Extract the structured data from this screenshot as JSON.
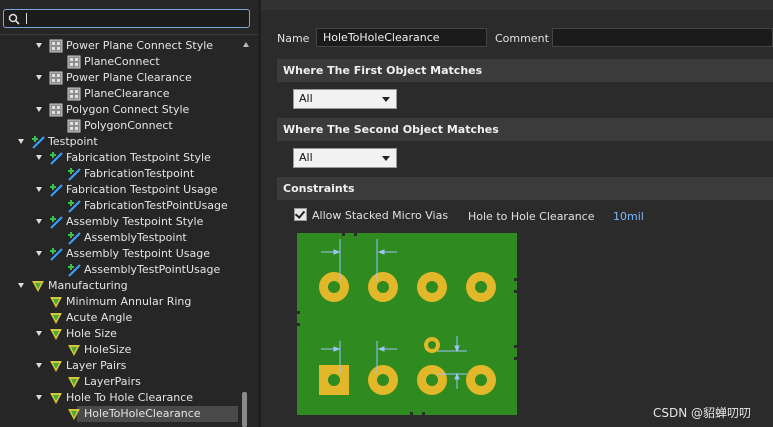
{
  "search": {
    "value": "",
    "placeholder": ""
  },
  "tree": {
    "rows": [
      {
        "label": "Power Plane Connect Style",
        "level": 3,
        "expanded": true,
        "icon": "rule-group-icon"
      },
      {
        "label": "PlaneConnect",
        "level": 4,
        "expanded": false,
        "icon": "rule-item-icon"
      },
      {
        "label": "Power Plane Clearance",
        "level": 3,
        "expanded": true,
        "icon": "rule-group-icon"
      },
      {
        "label": "PlaneClearance",
        "level": 4,
        "expanded": false,
        "icon": "rule-item-icon"
      },
      {
        "label": "Polygon Connect Style",
        "level": 3,
        "expanded": true,
        "icon": "rule-group-icon"
      },
      {
        "label": "PolygonConnect",
        "level": 4,
        "expanded": false,
        "icon": "rule-item-icon"
      },
      {
        "label": "Testpoint",
        "level": 2,
        "expanded": true,
        "icon": "testpoint-icon"
      },
      {
        "label": "Fabrication Testpoint Style",
        "level": 3,
        "expanded": true,
        "icon": "testpoint-icon"
      },
      {
        "label": "FabricationTestpoint",
        "level": 4,
        "expanded": false,
        "icon": "testpoint-icon"
      },
      {
        "label": "Fabrication Testpoint Usage",
        "level": 3,
        "expanded": true,
        "icon": "testpoint-icon"
      },
      {
        "label": "FabricationTestPointUsage",
        "level": 4,
        "expanded": false,
        "icon": "testpoint-icon"
      },
      {
        "label": "Assembly Testpoint Style",
        "level": 3,
        "expanded": true,
        "icon": "testpoint-icon"
      },
      {
        "label": "AssemblyTestpoint",
        "level": 4,
        "expanded": false,
        "icon": "testpoint-icon"
      },
      {
        "label": "Assembly Testpoint Usage",
        "level": 3,
        "expanded": true,
        "icon": "testpoint-icon"
      },
      {
        "label": "AssemblyTestPointUsage",
        "level": 4,
        "expanded": false,
        "icon": "testpoint-icon"
      },
      {
        "label": "Manufacturing",
        "level": 2,
        "expanded": true,
        "icon": "manufacturing-icon"
      },
      {
        "label": "Minimum Annular Ring",
        "level": 3,
        "expanded": false,
        "icon": "manufacturing-icon"
      },
      {
        "label": "Acute Angle",
        "level": 3,
        "expanded": false,
        "icon": "manufacturing-icon"
      },
      {
        "label": "Hole Size",
        "level": 3,
        "expanded": true,
        "icon": "manufacturing-icon"
      },
      {
        "label": "HoleSize",
        "level": 4,
        "expanded": false,
        "icon": "manufacturing-icon"
      },
      {
        "label": "Layer Pairs",
        "level": 3,
        "expanded": true,
        "icon": "manufacturing-icon"
      },
      {
        "label": "LayerPairs",
        "level": 4,
        "expanded": false,
        "icon": "manufacturing-icon"
      },
      {
        "label": "Hole To Hole Clearance",
        "level": 3,
        "expanded": true,
        "icon": "manufacturing-icon"
      },
      {
        "label": "HoleToHoleClearance",
        "level": 4,
        "expanded": false,
        "icon": "manufacturing-icon",
        "selected": true
      }
    ]
  },
  "rule": {
    "name_label": "Name",
    "name_value": "HoleToHoleClearance",
    "comment_label": "Comment",
    "comment_value": ""
  },
  "first_match": {
    "title": "Where The First Object Matches",
    "selected": "All"
  },
  "second_match": {
    "title": "Where The Second Object Matches",
    "selected": "All"
  },
  "constraints": {
    "title": "Constraints",
    "allow_stacked_label": "Allow Stacked Micro Vias",
    "allow_stacked_checked": true,
    "clearance_label": "Hole to Hole Clearance",
    "clearance_value": "10mil"
  },
  "colors": {
    "pcb_board": "#2f8a1f",
    "pad": "#e3b72a",
    "clearance_value": "#7fb7ff",
    "arrow": "#9ec3ff"
  },
  "watermark": "CSDN @貂蝉叨叨"
}
